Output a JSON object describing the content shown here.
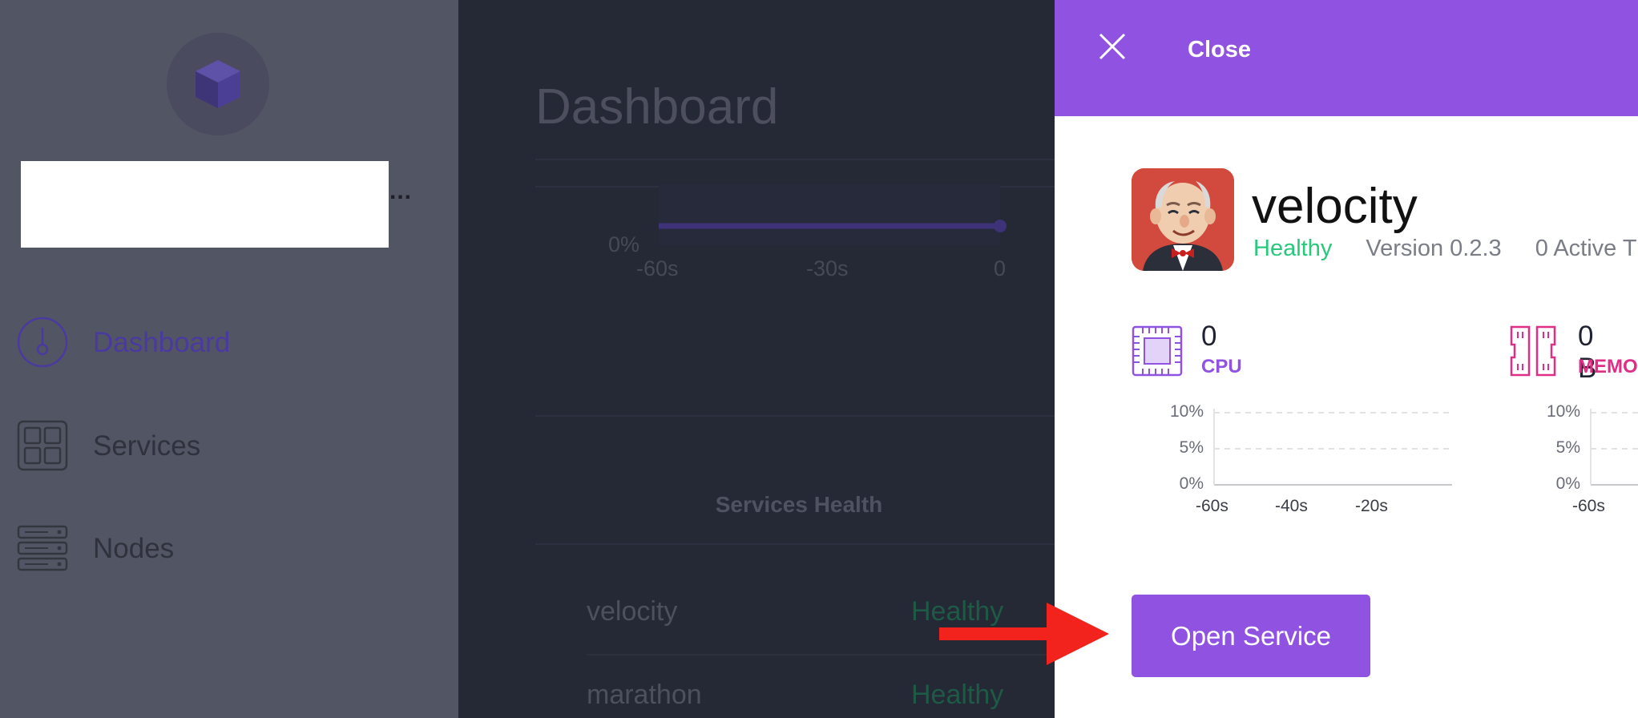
{
  "sidebar": {
    "items": [
      {
        "label": "Dashboard",
        "icon": "gauge-icon"
      },
      {
        "label": "Services",
        "icon": "services-grid-icon"
      },
      {
        "label": "Nodes",
        "icon": "nodes-server-icon"
      }
    ],
    "cluster_name_ellipsis": "..."
  },
  "main": {
    "title": "Dashboard",
    "mini_chart": {
      "y_tick": "0%",
      "x_ticks": [
        "-60s",
        "-30s",
        "0"
      ]
    },
    "services_health": {
      "heading": "Services Health",
      "rows": [
        {
          "name": "velocity",
          "status": "Healthy"
        },
        {
          "name": "marathon",
          "status": "Healthy"
        }
      ]
    }
  },
  "panel": {
    "close_label": "Close",
    "service": {
      "name": "velocity",
      "health": "Healthy",
      "version": "Version 0.2.3",
      "active_tasks": "0 Active T"
    },
    "metrics": {
      "cpu": {
        "value": "0",
        "label": "CPU"
      },
      "memory": {
        "value": "0 B",
        "label": "MEMO"
      }
    },
    "cpu_chart": {
      "y_ticks": [
        "10%",
        "5%",
        "0%"
      ],
      "x_ticks": [
        "-60s",
        "-40s",
        "-20s"
      ]
    },
    "mem_chart": {
      "y_ticks": [
        "10%",
        "5%",
        "0%"
      ],
      "x_ticks": [
        "-60s"
      ]
    },
    "open_service_label": "Open Service"
  },
  "colors": {
    "accent": "#9052e1",
    "healthy": "#27c97b",
    "memory": "#e02e86",
    "annotation_arrow": "#f2231c"
  }
}
